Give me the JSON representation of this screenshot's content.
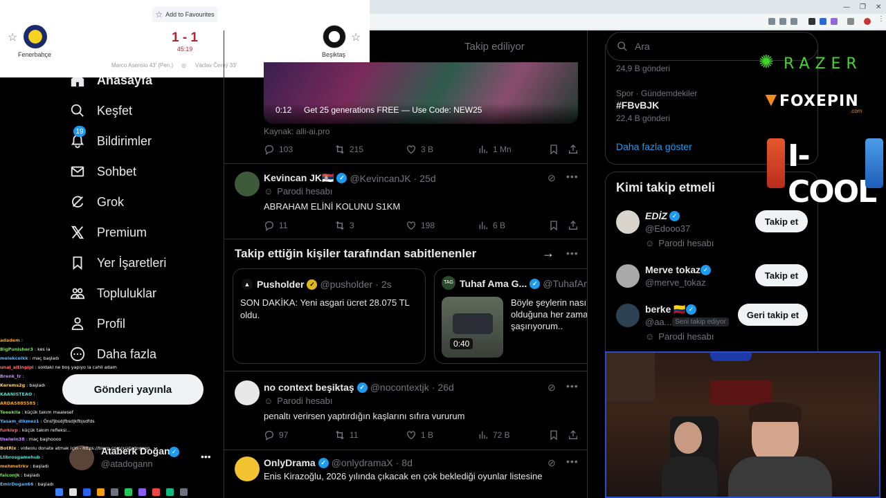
{
  "score_widget": {
    "favourite_label": "Add to Favourites",
    "home_team": "Fenerbahçe",
    "away_team": "Beşiktaş",
    "score": "1 - 1",
    "minute": "45:19",
    "home_scorer": "Marco Asensio 43' (Pen.)",
    "away_scorer": "Václav Černý 33'",
    "colors": {
      "score": "#b0262f"
    }
  },
  "nav": {
    "items": [
      {
        "label": "Anasayfa",
        "icon": "home-icon"
      },
      {
        "label": "Keşfet",
        "icon": "search-icon"
      },
      {
        "label": "Bildirimler",
        "icon": "bell-icon",
        "badge": "19"
      },
      {
        "label": "Sohbet",
        "icon": "mail-icon"
      },
      {
        "label": "Grok",
        "icon": "grok-icon"
      },
      {
        "label": "Premium",
        "icon": "x-logo-icon"
      },
      {
        "label": "Yer İşaretleri",
        "icon": "bookmark-icon"
      },
      {
        "label": "Topluluklar",
        "icon": "communities-icon"
      },
      {
        "label": "Profil",
        "icon": "person-icon"
      },
      {
        "label": "Daha fazla",
        "icon": "more-circle-icon"
      }
    ],
    "post_button": "Gönderi yayınla",
    "account": {
      "name": "Ataberk Doğan",
      "handle": "@atadogann"
    }
  },
  "chat": [
    {
      "user": "adadem",
      "msg": ""
    },
    {
      "user": "BigPunisher3",
      "msg": "kes la"
    },
    {
      "user": "melekcelkk",
      "msg": "maç başladı"
    },
    {
      "user": "unal_altinpipi",
      "msg": "soldaki ne boş yapıyo la cahil adam"
    },
    {
      "user": "Brenk_tr",
      "msg": ""
    },
    {
      "user": "Kerems2g",
      "msg": "başladı"
    },
    {
      "user": "KAANISTEAO",
      "msg": ""
    },
    {
      "user": "ARDAS885585",
      "msg": ""
    },
    {
      "user": "Teeekila",
      "msg": "küçük takım maalesef"
    },
    {
      "user": "Yasam_dikmez1",
      "msg": "Ónsfjbsdjfbsdjkfbjsdfds"
    },
    {
      "user": "furkivp",
      "msg": "küçük takım refleksi..."
    },
    {
      "user": "thelwin38",
      "msg": "maç başhoooo"
    },
    {
      "user": "BotRix",
      "msg": "videolu donate atmak için - https://blerp.com/x/atadogann"
    },
    {
      "user": "Llibrosgamehub",
      "msg": ""
    },
    {
      "user": "mehmetrkv",
      "msg": "başladı"
    },
    {
      "user": "falconjk",
      "msg": "başladı"
    },
    {
      "user": "EmirDogan66",
      "msg": "başladı"
    }
  ],
  "feed": {
    "tab_following": "Takip ediliyor",
    "promo_tweet": {
      "video_time": "0:12",
      "video_caption": "Get 25 generations FREE — Use Code: NEW25",
      "source": "Kaynak: alli-ai.pro",
      "replies": "103",
      "reposts": "215",
      "likes": "3 B",
      "views": "1 Mn"
    },
    "tweets": [
      {
        "name": "Kevincan JK🇷🇸",
        "handle": "@KevincanJK",
        "time": "25d",
        "parody": "Parodi hesabı",
        "text": "ABRAHAM ELİNİ KOLUNU S1KM",
        "replies": "11",
        "reposts": "3",
        "likes": "198",
        "views": "6 B"
      },
      {
        "name": "no context beşiktaş",
        "handle": "@nocontextjk",
        "time": "26d",
        "parody": "Parodi hesabı",
        "text": "penaltı verirsen yaptırdığın kaşlarını sıfıra vururum",
        "replies": "97",
        "reposts": "11",
        "likes": "1 B",
        "views": "72 B"
      },
      {
        "name": "OnlyDrama",
        "handle": "@onlydramaX",
        "time": "8d",
        "text": "Enis Kirazoğlu, 2026 yılında çıkacak en çok beklediği oyunlar listesine"
      }
    ],
    "pinned": {
      "title": "Takip ettiğin kişiler tarafından sabitlenenler",
      "cards": [
        {
          "name": "Pusholder",
          "handle": "@pusholder",
          "time": "2s",
          "text": "SON DAKİKA: Yeni asgari ücret 28.075 TL oldu."
        },
        {
          "name": "Tuhaf Ama G...",
          "handle": "@TuhafAma",
          "video_time": "0:40",
          "text": "Böyle şeylerin nası olduğuna her zama şaşırıyorum.."
        }
      ]
    }
  },
  "right": {
    "search_placeholder": "Ara",
    "trends": [
      {
        "category": "",
        "name": "",
        "count": "24,9 B gönderi"
      },
      {
        "category": "Spor · Gündemdekiler",
        "name": "#FBvBJK",
        "count": "22,4 B gönderi"
      }
    ],
    "show_more": "Daha fazla göster",
    "who_to_follow": {
      "title": "Kimi takip etmeli",
      "accounts": [
        {
          "name": "EDİZ",
          "handle": "@Edooo37",
          "note": "Parodi hesabı",
          "button": "Takip et"
        },
        {
          "name": "Merve tokaz",
          "handle": "@merve_tokaz",
          "note": "",
          "button": "Takip et"
        },
        {
          "name": "berke 🇨🇴",
          "handle": "@aa...",
          "follows_you": "Seni takip ediyor",
          "note": "Parodi hesabı",
          "button": "Geri takip et"
        }
      ]
    }
  },
  "sponsors": {
    "razer": "RAZER",
    "foxepin": "FOXEPIN",
    "foxepin_sub": ".com",
    "icool": "I-COOL",
    "colors": {
      "razer": "#44d62c",
      "foxepin": "#f28a1c",
      "icool": "#2f7bd8"
    }
  }
}
